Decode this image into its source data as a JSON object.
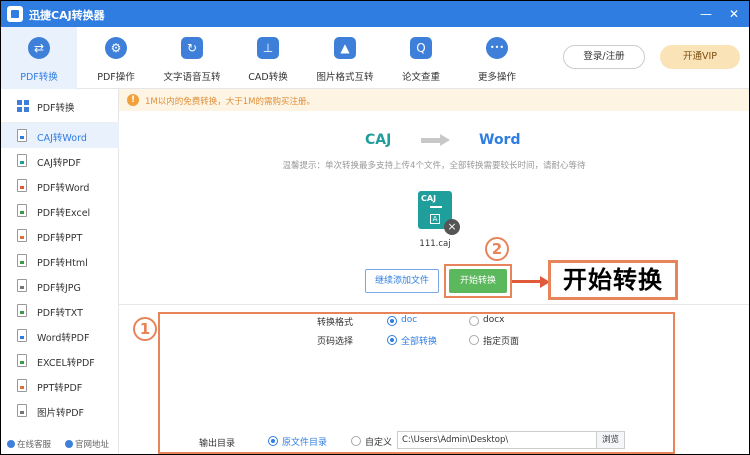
{
  "app": {
    "title": "迅捷CAJ转换器"
  },
  "window_buttons": {
    "minimize": "—",
    "close": "✕"
  },
  "toolbar": {
    "items": [
      {
        "label": "PDF转换",
        "icon": "⇄"
      },
      {
        "label": "PDF操作",
        "icon": "⚙"
      },
      {
        "label": "文字语音互转",
        "icon": "↻"
      },
      {
        "label": "CAD转换",
        "icon": "⊥"
      },
      {
        "label": "图片格式互转",
        "icon": "▲"
      },
      {
        "label": "论文查重",
        "icon": "Q"
      },
      {
        "label": "更多操作",
        "icon": "•••"
      }
    ],
    "active_index": 0,
    "login_label": "登录/注册",
    "vip_label": "开通VIP"
  },
  "sidebar": {
    "header": "PDF转换",
    "items": [
      {
        "label": "CAJ转Word"
      },
      {
        "label": "CAJ转PDF"
      },
      {
        "label": "PDF转Word"
      },
      {
        "label": "PDF转Excel"
      },
      {
        "label": "PDF转PPT"
      },
      {
        "label": "PDF转Html"
      },
      {
        "label": "PDF转JPG"
      },
      {
        "label": "PDF转TXT"
      },
      {
        "label": "Word转PDF"
      },
      {
        "label": "EXCEL转PDF"
      },
      {
        "label": "PPT转PDF"
      },
      {
        "label": "图片转PDF"
      }
    ],
    "active_index": 0,
    "footer": {
      "service": "在线客服",
      "website": "官网地址"
    }
  },
  "notice": {
    "text": "1M以内的免费转换，大于1M的需购买注册。"
  },
  "conversion": {
    "from": "CAJ",
    "to": "Word",
    "tip": "温馨提示：单次转换最多支持上传4个文件，全部转换需要较长时间，请耐心等待"
  },
  "file": {
    "name": "111.caj",
    "type_tag": "CAJ",
    "glyph": "A"
  },
  "actions": {
    "add_files": "继续添加文件",
    "start": "开始转换"
  },
  "annotations": {
    "mark1": "1",
    "mark2": "2",
    "callout": "开始转换"
  },
  "settings": {
    "format_label": "转换格式",
    "format_options": [
      "doc",
      "docx"
    ],
    "format_selected": "doc",
    "page_label": "页码选择",
    "page_options": [
      "全部转换",
      "指定页面"
    ],
    "page_selected": "全部转换",
    "output_label": "输出目录",
    "output_options": [
      "原文件目录",
      "自定义"
    ],
    "output_selected": "原文件目录",
    "output_path": "C:\\Users\\Admin\\Desktop\\",
    "browse_label": "浏览"
  },
  "colors": {
    "brand": "#2f7de1",
    "caj_teal": "#1f9e9b",
    "start_green": "#5cb85c",
    "annotation_orange": "#e8845a",
    "notice_bg": "#fdf4e4"
  }
}
